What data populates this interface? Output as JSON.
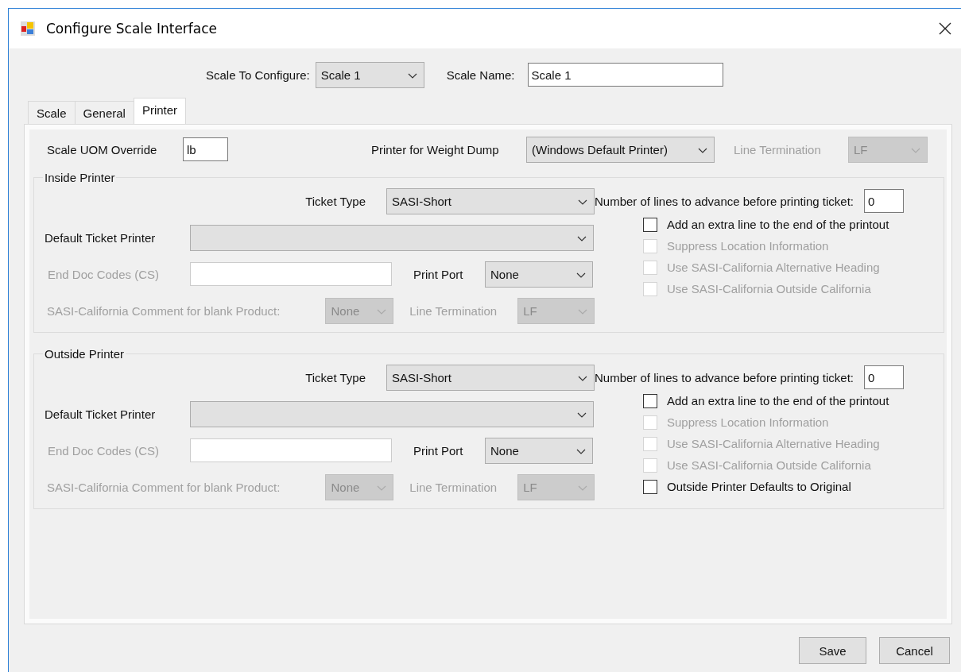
{
  "window": {
    "title": "Configure Scale Interface"
  },
  "header": {
    "scale_to_configure": {
      "label": "Scale To Configure:",
      "value": "Scale 1"
    },
    "scale_name": {
      "label": "Scale Name:",
      "value": "Scale 1"
    }
  },
  "tabs": [
    {
      "label": "Scale",
      "selected": false
    },
    {
      "label": "General",
      "selected": false
    },
    {
      "label": "Printer",
      "selected": true
    }
  ],
  "printer_tab": {
    "uom_override": {
      "label": "Scale UOM Override",
      "value": "lb"
    },
    "weight_dump": {
      "label": "Printer for Weight Dump",
      "value": "(Windows Default Printer)"
    },
    "line_termination": {
      "label": "Line Termination",
      "value": "LF",
      "disabled": true
    },
    "groups": [
      {
        "title": "Inside Printer",
        "ticket_type": {
          "label": "Ticket Type",
          "value": "SASI-Short"
        },
        "default_printer": {
          "label": "Default Ticket Printer"
        },
        "end_doc_codes": {
          "label": "End Doc Codes (CS)",
          "disabled": true
        },
        "print_port": {
          "label": "Print Port",
          "value": "None"
        },
        "comment": {
          "label": "SASI-California Comment for blank Product:",
          "value": "None",
          "disabled": true
        },
        "line_termination": {
          "label": "Line Termination",
          "value": "LF",
          "disabled": true
        },
        "lines_advance": {
          "label": "Number of lines to advance before printing ticket:",
          "value": "0"
        },
        "options": [
          {
            "label": "Add an extra line to the end of the printout",
            "checked": false,
            "disabled": false
          },
          {
            "label": "Suppress Location Information",
            "checked": false,
            "disabled": true
          },
          {
            "label": "Use SASI-California Alternative Heading",
            "checked": false,
            "disabled": true
          },
          {
            "label": "Use SASI-California Outside California",
            "checked": false,
            "disabled": true
          }
        ]
      },
      {
        "title": "Outside Printer",
        "ticket_type": {
          "label": "Ticket Type",
          "value": "SASI-Short"
        },
        "default_printer": {
          "label": "Default Ticket Printer"
        },
        "end_doc_codes": {
          "label": "End Doc Codes (CS)",
          "disabled": true
        },
        "print_port": {
          "label": "Print Port",
          "value": "None"
        },
        "comment": {
          "label": "SASI-California Comment for blank Product:",
          "value": "None",
          "disabled": true
        },
        "line_termination": {
          "label": "Line Termination",
          "value": "LF",
          "disabled": true
        },
        "lines_advance": {
          "label": "Number of lines to advance before printing ticket:",
          "value": "0"
        },
        "options": [
          {
            "label": "Add an extra line to the end of the printout",
            "checked": false,
            "disabled": false
          },
          {
            "label": "Suppress Location Information",
            "checked": false,
            "disabled": true
          },
          {
            "label": "Use SASI-California Alternative Heading",
            "checked": false,
            "disabled": true
          },
          {
            "label": "Use SASI-California Outside California",
            "checked": false,
            "disabled": true
          },
          {
            "label": "Outside Printer Defaults to Original",
            "checked": false,
            "disabled": false
          }
        ]
      }
    ]
  },
  "buttons": [
    "Save",
    "Cancel"
  ]
}
